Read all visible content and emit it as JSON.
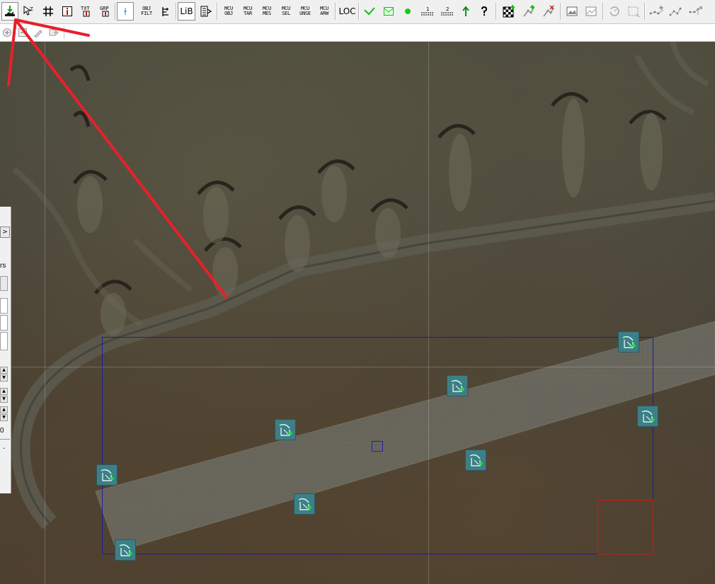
{
  "toolbar": {
    "items": [
      {
        "name": "create-object-button",
        "type": "icon",
        "icon": "down-arrow-ground-icon"
      },
      {
        "name": "zoom-select-button",
        "type": "icon",
        "icon": "select-zoom-icon"
      },
      {
        "name": "grid-button",
        "type": "icon",
        "icon": "grid-icon"
      },
      {
        "name": "info-button",
        "type": "icon",
        "icon": "info-icon"
      },
      {
        "name": "text-button",
        "type": "icon",
        "icon": "text-label-icon",
        "label": "TXT"
      },
      {
        "name": "graph-button",
        "type": "icon",
        "icon": "graph-icon",
        "label": "GRP"
      },
      {
        "name": "filter-toggle-button",
        "type": "icon",
        "icon": "filter-icon"
      },
      {
        "name": "object-filter-button",
        "type": "text2",
        "line1": "OBJ",
        "line2": "FILT"
      },
      {
        "name": "align-button",
        "type": "icon",
        "icon": "align-icon"
      },
      {
        "name": "library-button",
        "type": "text1",
        "label": "LiB"
      },
      {
        "name": "properties-button",
        "type": "icon",
        "icon": "properties-icon"
      },
      {
        "name": "mcu-object-button",
        "type": "text2",
        "line1": "MCU",
        "line2": "OBJ"
      },
      {
        "name": "mcu-target-button",
        "type": "text2",
        "line1": "MCU",
        "line2": "TAR"
      },
      {
        "name": "mcu-message-button",
        "type": "text2",
        "line1": "MCU",
        "line2": "MES"
      },
      {
        "name": "mcu-select-button",
        "type": "text2",
        "line1": "MCU",
        "line2": "SEL"
      },
      {
        "name": "mcu-unselect-button",
        "type": "text2",
        "line1": "MCU",
        "line2": "UNSE"
      },
      {
        "name": "mcu-arrow-button",
        "type": "text2",
        "line1": "MCU",
        "line2": "ARW"
      },
      {
        "name": "location-button",
        "type": "text1",
        "label": "LOC"
      }
    ],
    "right_icons": [
      "green-check-icon",
      "green-envelope-icon",
      "green-dot-icon",
      "layer-1-icon",
      "layer-2-icon",
      "green-arrow-up-icon",
      "help-icon",
      "checkerboard-icon",
      "add-waypoint-icon",
      "remove-waypoint-icon",
      "image-icon",
      "picture-icon",
      "rotate-icon",
      "select-rect-icon",
      "path-add-icon",
      "path-edit-icon",
      "path-delete-icon"
    ],
    "layer1_label": "1",
    "layer2_label": "2"
  },
  "toolbar2": {
    "icons": [
      "add-icon",
      "minus-icon",
      "edit-icon",
      "send-icon"
    ]
  },
  "left_panel": {
    "arrow_label": ">",
    "text_fragment": "rs",
    "value": "0"
  },
  "map": {
    "mcu_icons": [
      {
        "name": "mcu-icon-1"
      },
      {
        "name": "mcu-icon-2"
      },
      {
        "name": "mcu-icon-3"
      },
      {
        "name": "mcu-icon-4"
      },
      {
        "name": "mcu-icon-5"
      },
      {
        "name": "mcu-icon-6"
      },
      {
        "name": "mcu-icon-7"
      },
      {
        "name": "mcu-icon-8"
      }
    ]
  },
  "colors": {
    "selection": "#1c1ca0",
    "highlight": "#e01010",
    "annotation_arrow": "#e8202a",
    "mcu_fill": "#3d7f86",
    "mcu_accent": "#22e040"
  }
}
